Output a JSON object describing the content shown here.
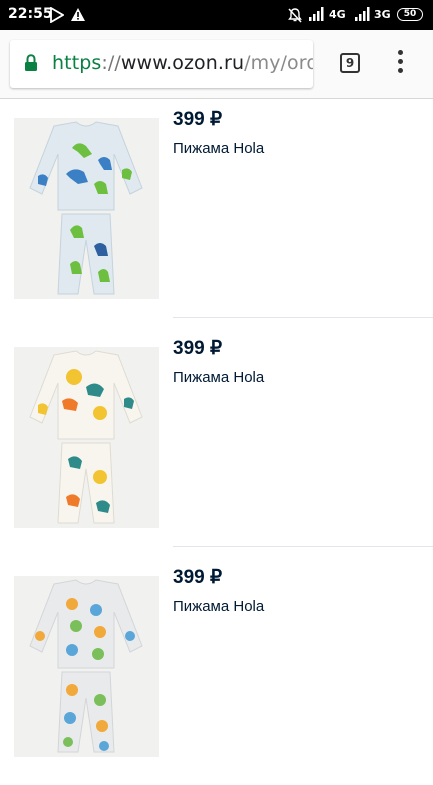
{
  "status_bar": {
    "time": "22:55",
    "network_1": "4G",
    "network_2": "3G",
    "battery": "50"
  },
  "browser": {
    "url_scheme": "https",
    "url_sep": "://",
    "url_host": "www.ozon.ru",
    "url_path": "/my/orde",
    "tab_count": "9",
    "icons": [
      "lock-icon",
      "tab-switcher-icon",
      "overflow-menu-icon"
    ]
  },
  "products": [
    {
      "price": "399 ₽",
      "name": "Пижама Hola",
      "print": "dinosaurs",
      "colors": [
        "#6dbf3f",
        "#3b7fc4",
        "#2e5f9e"
      ]
    },
    {
      "price": "399 ₽",
      "name": "Пижама Hola",
      "print": "chameleons",
      "colors": [
        "#f2c431",
        "#2f8a8a",
        "#ef7a2a"
      ]
    },
    {
      "price": "399 ₽",
      "name": "Пижама Hola",
      "print": "animals",
      "colors": [
        "#f0a93a",
        "#5aa6d8",
        "#7bbf5a"
      ]
    }
  ]
}
